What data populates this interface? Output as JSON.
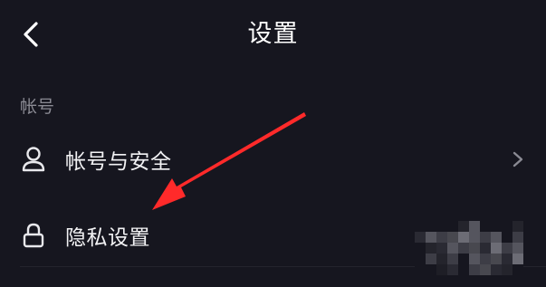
{
  "nav": {
    "title": "设置",
    "back_icon": "chevron-left-icon"
  },
  "sections": [
    {
      "header": "帐号",
      "items": [
        {
          "label": "帐号与安全",
          "icon": "user-icon",
          "has_chevron": true
        },
        {
          "label": "隐私设置",
          "icon": "lock-icon",
          "has_chevron": false
        }
      ]
    }
  ],
  "colors": {
    "background": "#16161f",
    "primary_text": "#f2f2f4",
    "secondary_text": "#8a8a93",
    "annotation_arrow": "#ff2a2a"
  }
}
